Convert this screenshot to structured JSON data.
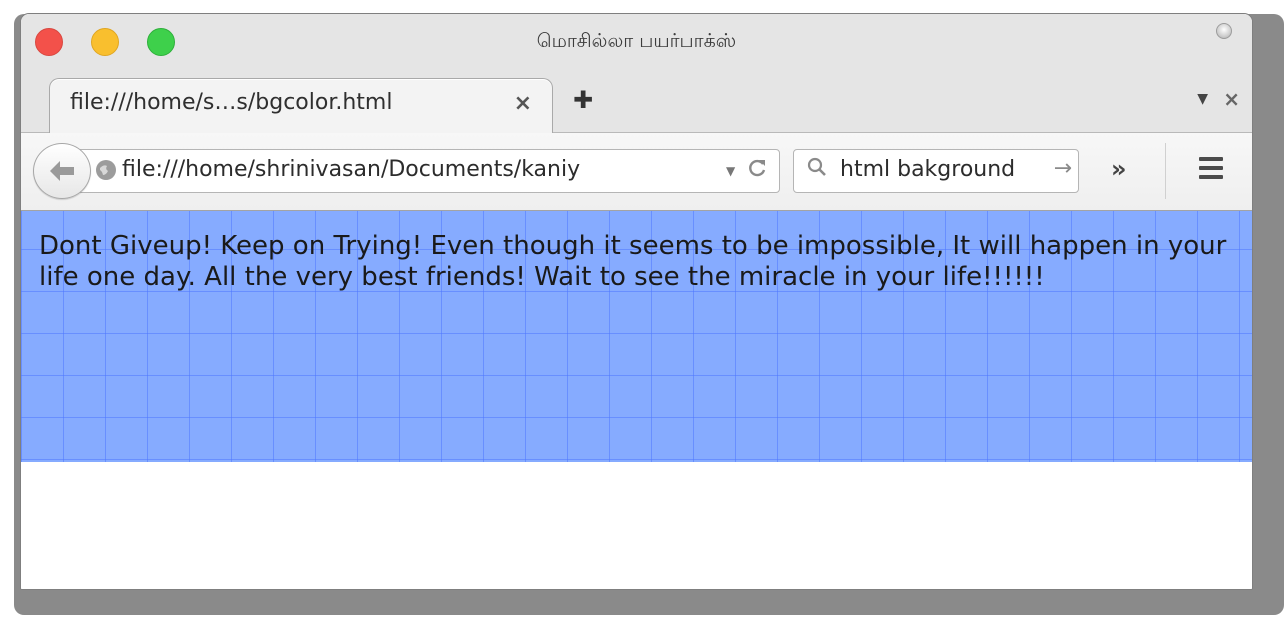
{
  "window": {
    "title": "மொசில்லா பயர்பாக்ஸ்"
  },
  "tabs": [
    {
      "label": "file:///home/s…s/bgcolor.html",
      "close_icon": "×"
    }
  ],
  "tabstrip": {
    "new_tab_icon": "✚",
    "list_all_tabs_icon": "▼",
    "close_window_icon": "×"
  },
  "navbar": {
    "back_icon": "🡐",
    "url": "file:///home/shrinivasan/Documents/kaniy",
    "url_dropdown_icon": "▼",
    "reload_icon": "C",
    "search_query": "html bakground",
    "search_icon": "🔍",
    "search_go_icon": "→",
    "overflow_icon": "»"
  },
  "page": {
    "text": "Dont Giveup! Keep on Trying! Even though it seems to be impossible, It will happen in your life one day. All the very best friends! Wait to see the miracle in your life!!!!!!",
    "background_color": "#86abff"
  }
}
